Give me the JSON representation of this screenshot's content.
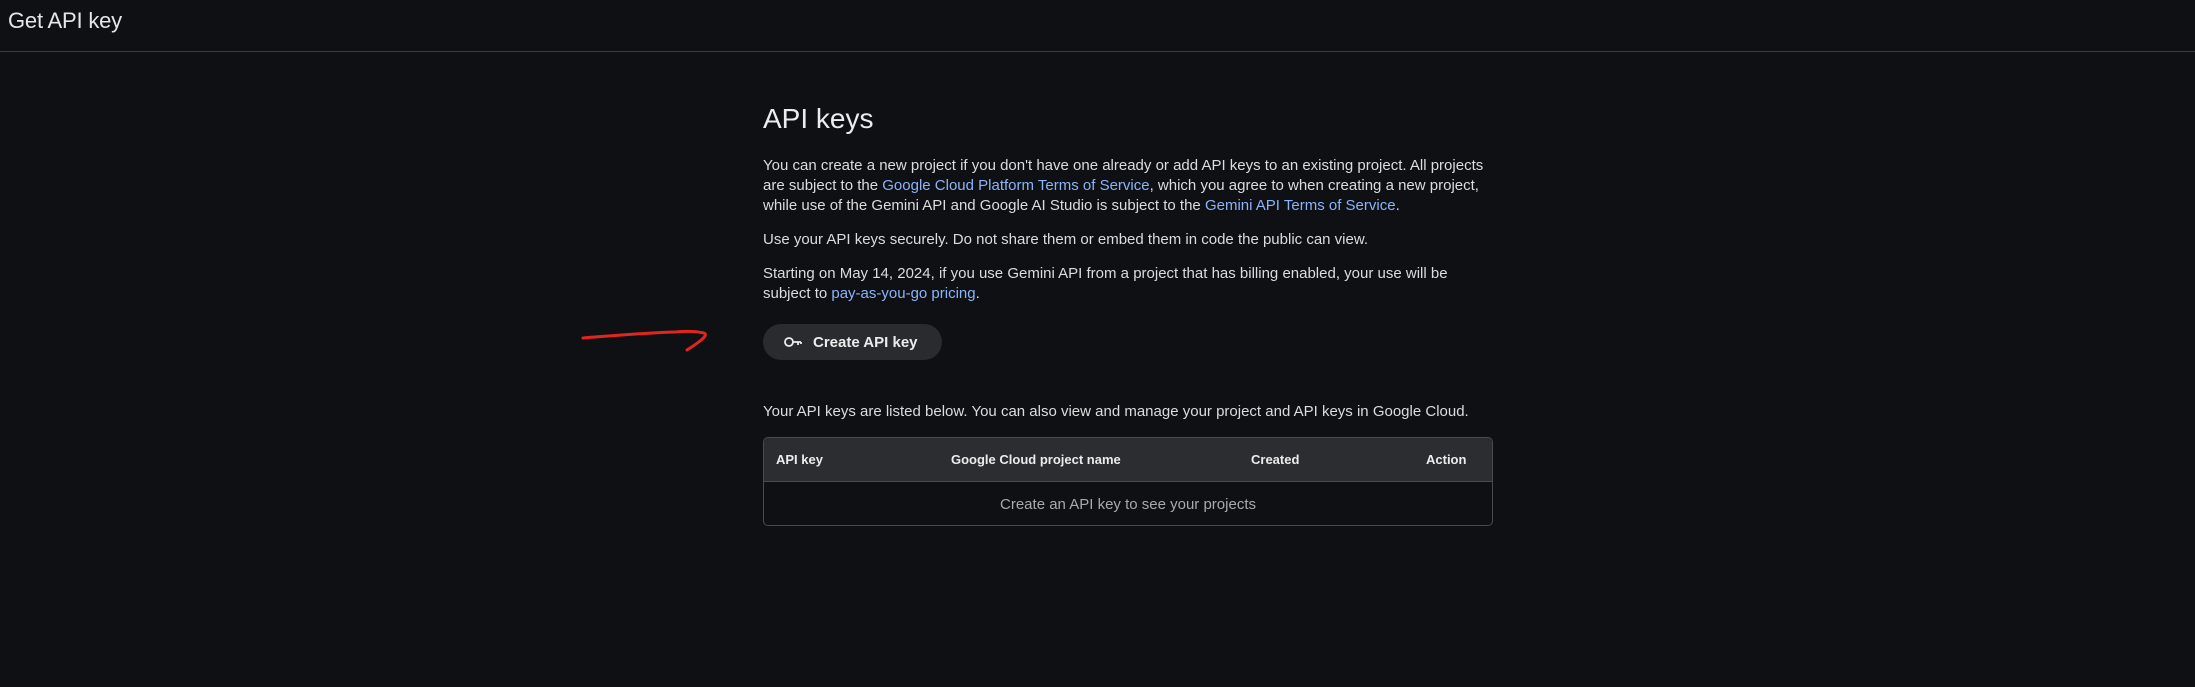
{
  "header": {
    "title": "Get API key"
  },
  "main": {
    "title": "API keys",
    "intro": {
      "part1": "You can create a new project if you don't have one already or add API keys to an existing project. All projects are subject to the ",
      "link1": "Google Cloud Platform Terms of Service",
      "part2": ", which you agree to when creating a new project, while use of the Gemini API and Google AI Studio is subject to the ",
      "link2": "Gemini API Terms of Service",
      "part3": "."
    },
    "security_note": "Use your API keys securely. Do not share them or embed them in code the public can view.",
    "billing": {
      "part1": "Starting on May 14, 2024, if you use Gemini API from a project that has billing enabled, your use will be subject to ",
      "link": "pay-as-you-go pricing",
      "part2": "."
    },
    "create_button": {
      "label": "Create API key",
      "icon": "key-icon"
    },
    "listed_text": "Your API keys are listed below. You can also view and manage your project and API keys in Google Cloud."
  },
  "table": {
    "columns": [
      "API key",
      "Google Cloud project name",
      "Created",
      "Action"
    ],
    "empty_message": "Create an API key to see your projects"
  },
  "colors": {
    "background": "#0f1013",
    "link": "#8ab4f8",
    "button_bg": "#2a2b2e",
    "annotation": "#e0261f"
  }
}
